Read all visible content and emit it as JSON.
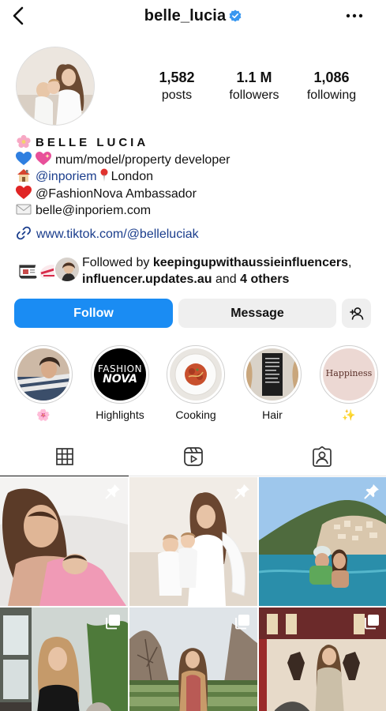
{
  "header": {
    "username": "belle_lucia",
    "back_icon": "chevron-left-icon",
    "verified_icon": "verified-badge-icon",
    "more_icon": "more-horizontal-icon"
  },
  "stats": [
    {
      "value": "1,582",
      "label": "posts"
    },
    {
      "value": "1.1 M",
      "label": "followers"
    },
    {
      "value": "1,086",
      "label": "following"
    }
  ],
  "bio": {
    "name": "BELLE LUCIA",
    "line1": "mum/model/property developer",
    "line2_mention": "@inporiem",
    "line2_location": "London",
    "line3": "@FashionNova Ambassador",
    "line4": "belle@inporiem.com",
    "link": "www.tiktok.com/@belleluciak"
  },
  "followed_by": {
    "prefix": "Followed by",
    "user1": "keepingupwithaussieinfluencers",
    "separator": ",",
    "user2": "influencer.updates.au",
    "and": "and",
    "others": "4 others"
  },
  "buttons": {
    "follow": "Follow",
    "message": "Message",
    "add_user_icon": "add-user-icon"
  },
  "highlights": [
    {
      "label": "🌸"
    },
    {
      "label": "Highlights",
      "cover_line1": "FASHION",
      "cover_line2": "NOVA"
    },
    {
      "label": "Cooking"
    },
    {
      "label": "Hair"
    },
    {
      "label": "✨",
      "cover_text": "Happiness"
    }
  ],
  "tabs": [
    {
      "icon": "grid-icon",
      "active": true
    },
    {
      "icon": "reels-icon",
      "active": false
    },
    {
      "icon": "tagged-icon",
      "active": false
    }
  ],
  "posts": [
    {
      "badge": "pin-icon"
    },
    {
      "badge": "pin-icon"
    },
    {
      "badge": "pin-icon"
    },
    {
      "badge": "carousel-icon"
    },
    {
      "badge": "carousel-icon"
    },
    {
      "badge": "carousel-icon"
    }
  ],
  "colors": {
    "follow_blue": "#1a8cf3",
    "link_blue": "#1a3d8c",
    "button_grey": "#efefef"
  }
}
